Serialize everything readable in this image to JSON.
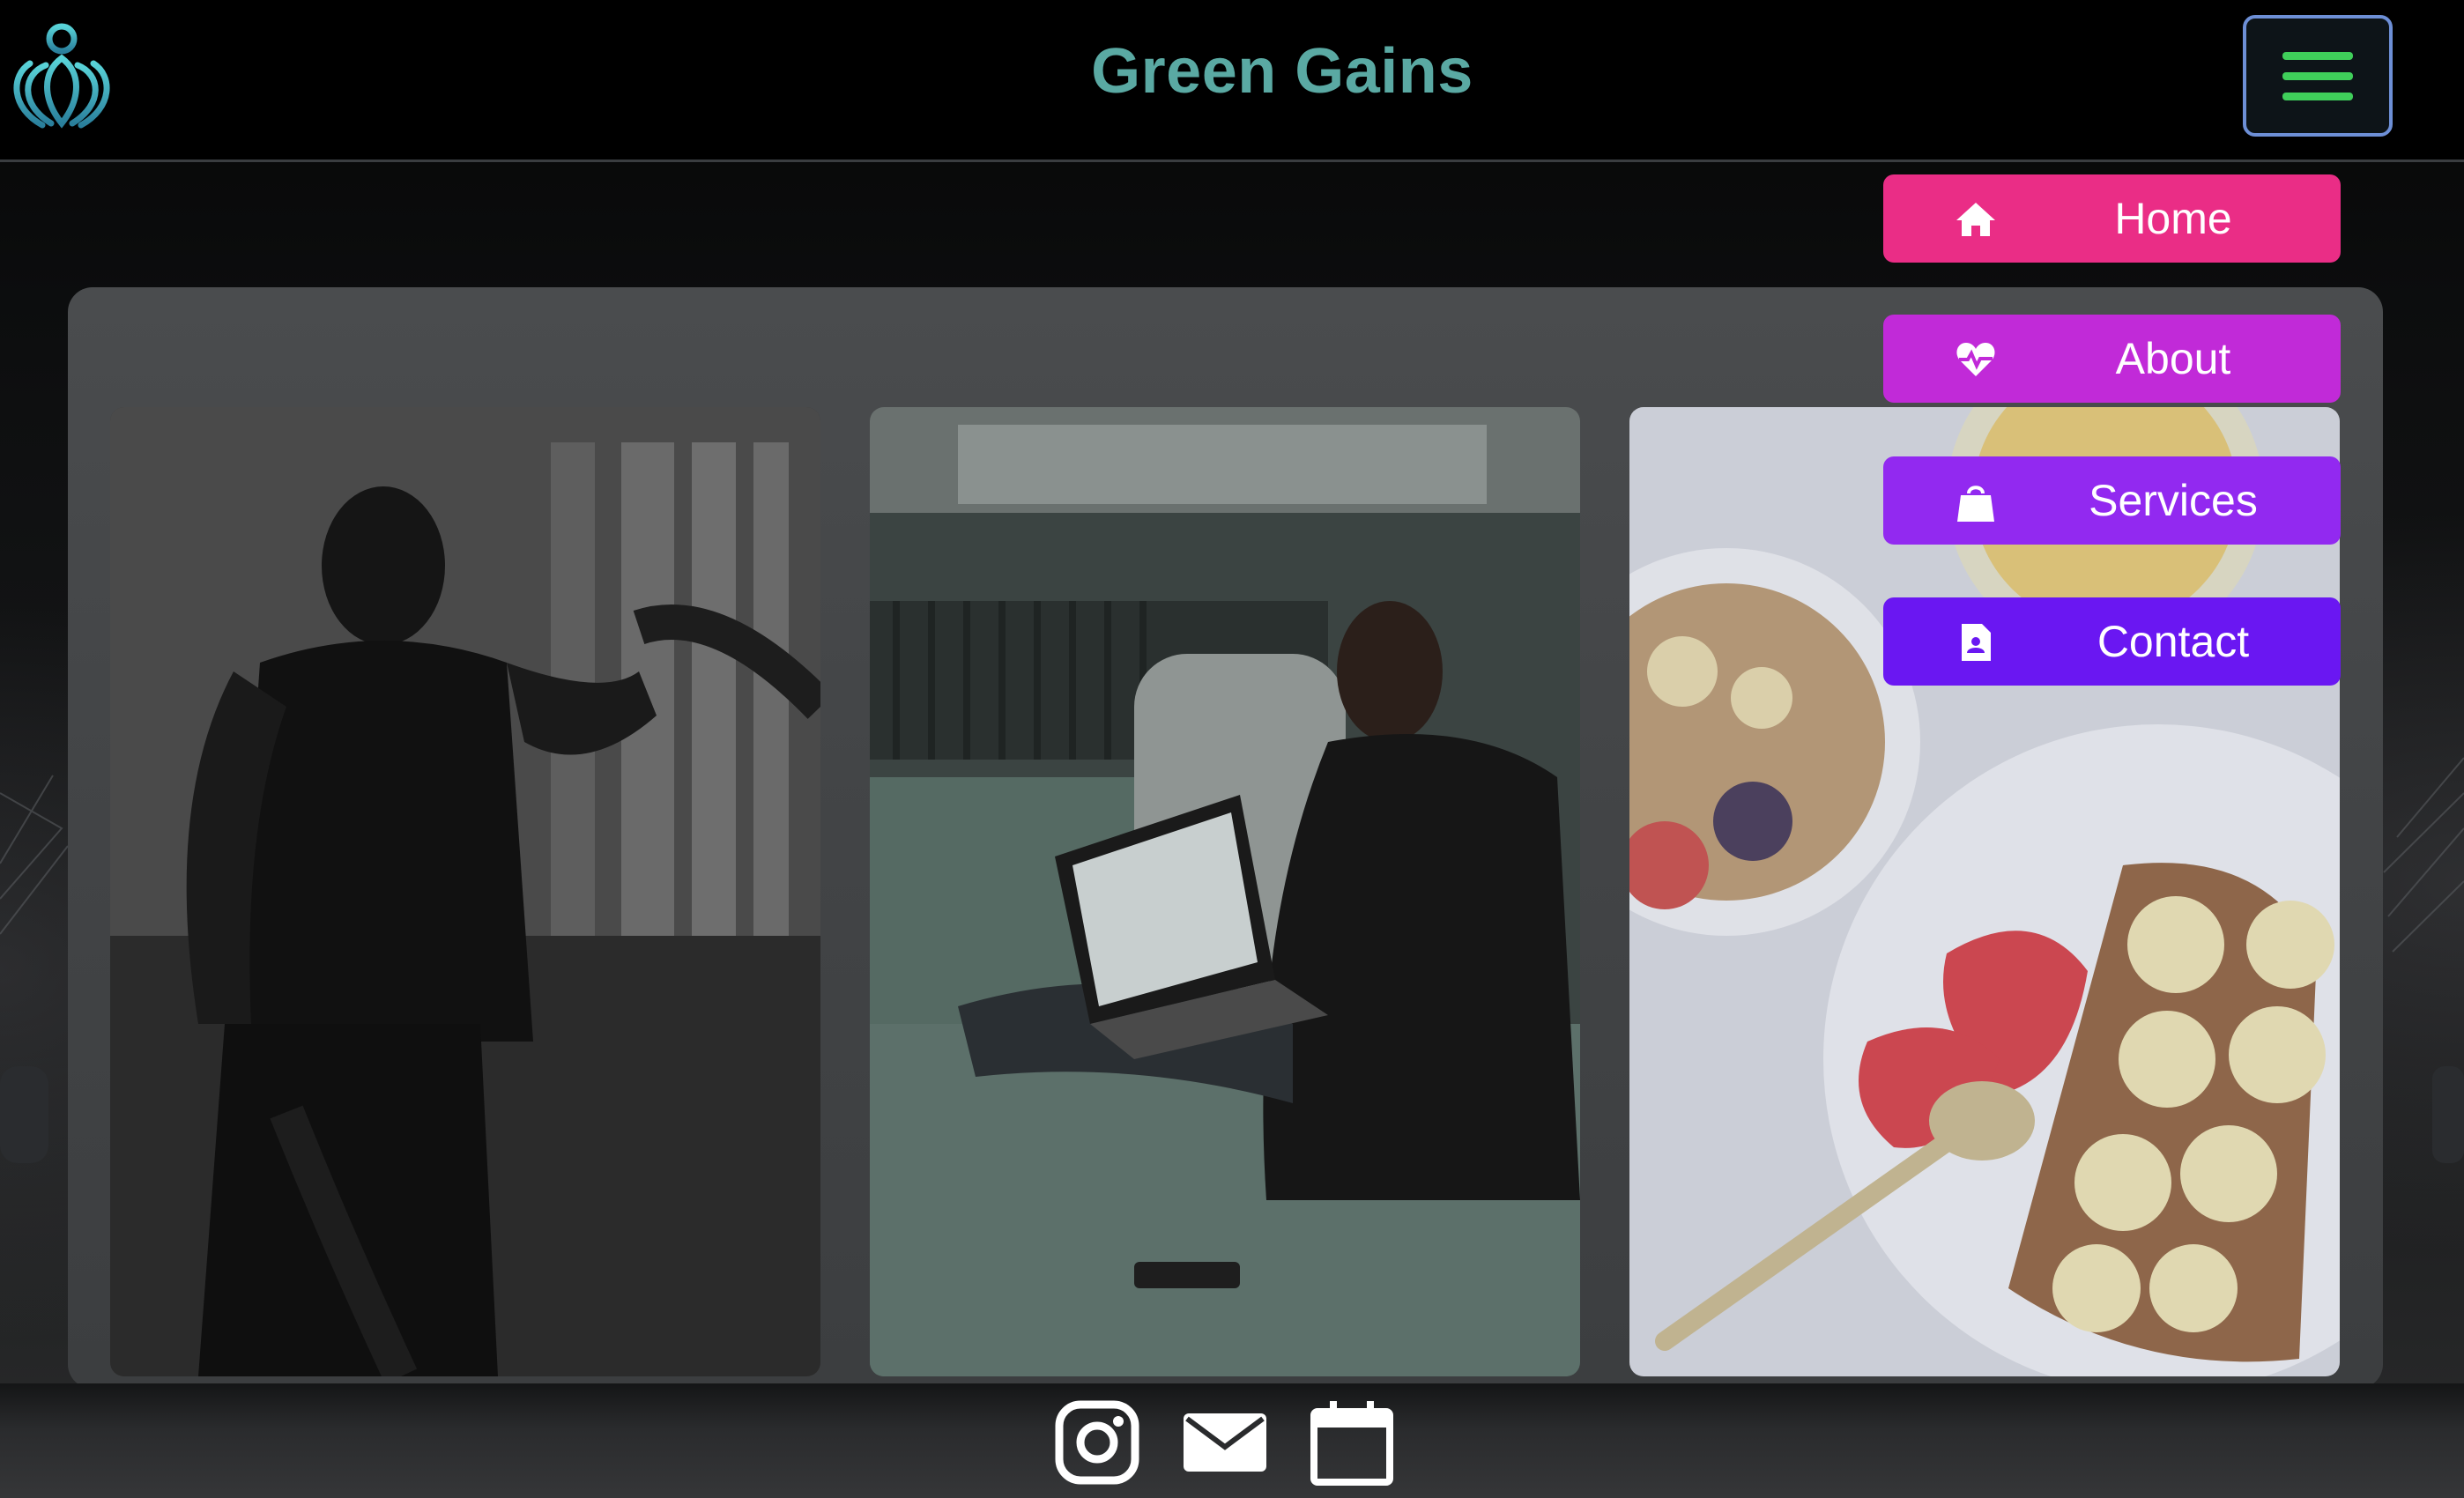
{
  "header": {
    "brand_title": "Green Gains",
    "logo_icon": "lotus-logo-icon",
    "menu_icon": "hamburger-menu-icon"
  },
  "nav": {
    "items": [
      {
        "label": "Home",
        "icon": "home-icon",
        "color": "#ea2d86"
      },
      {
        "label": "About",
        "icon": "heart-pulse-icon",
        "color": "#c12ad8"
      },
      {
        "label": "Services",
        "icon": "shopping-bag-icon",
        "color": "#9229f0"
      },
      {
        "label": "Contact",
        "icon": "contact-card-icon",
        "color": "#6a17f2"
      }
    ]
  },
  "gallery": {
    "photos": [
      {
        "subject": "battle-rope-workout-photo"
      },
      {
        "subject": "video-call-training-photo"
      },
      {
        "subject": "healthy-breakfast-photo"
      }
    ]
  },
  "footer": {
    "icons": [
      "instagram-icon",
      "mail-icon",
      "calendar-icon"
    ]
  },
  "colors": {
    "brand": "#5aa9a3",
    "menu_accent": "#3fcf5a",
    "menu_border": "#6d8fd6"
  }
}
